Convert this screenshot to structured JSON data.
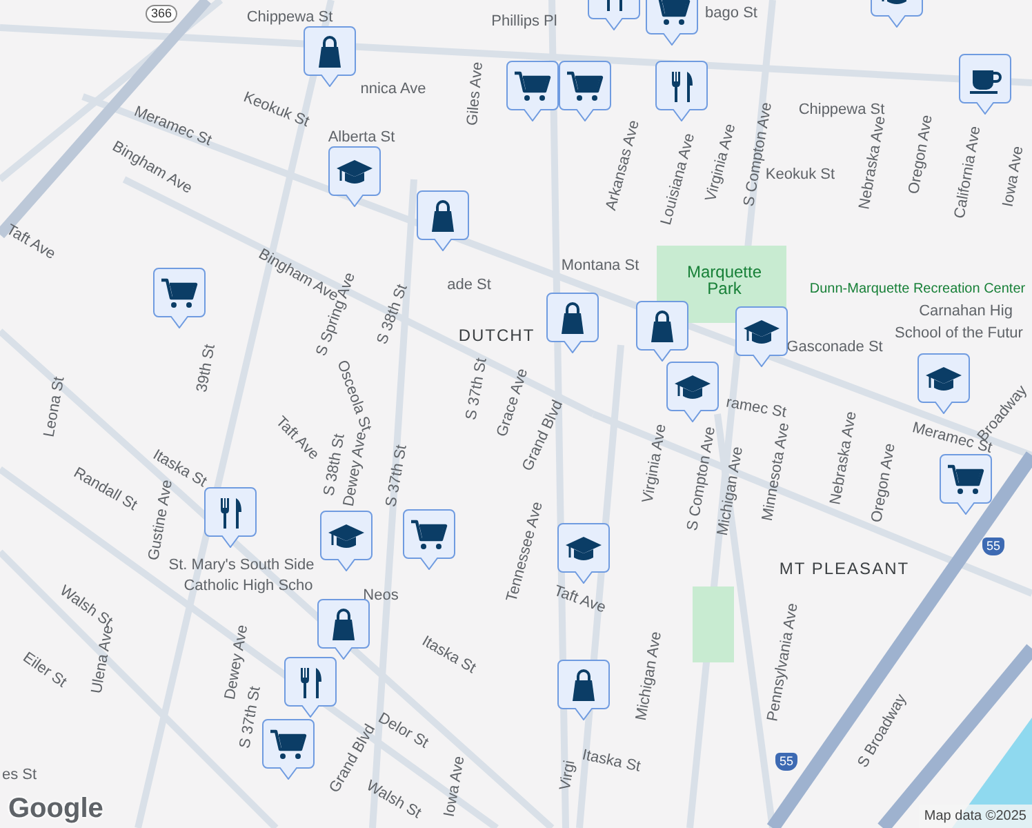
{
  "map": {
    "labels": [
      {
        "kind": "shield",
        "text": "366"
      },
      {
        "kind": "street",
        "text": "Chippewa St"
      },
      {
        "kind": "street",
        "text": "Phillips Pl"
      },
      {
        "kind": "street",
        "text": "bago St"
      },
      {
        "kind": "street",
        "text": "Meramec St"
      },
      {
        "kind": "street",
        "text": "Keokuk St"
      },
      {
        "kind": "street",
        "text": "nnica Ave"
      },
      {
        "kind": "street",
        "text": "Bingham Ave"
      },
      {
        "kind": "street",
        "text": "Giles Ave"
      },
      {
        "kind": "street",
        "text": "Chippewa St"
      },
      {
        "kind": "street",
        "text": "Alberta St"
      },
      {
        "kind": "street",
        "text": "Arkansas Ave"
      },
      {
        "kind": "street",
        "text": "Louisiana Ave"
      },
      {
        "kind": "street",
        "text": "Virginia Ave"
      },
      {
        "kind": "street",
        "text": "S Compton Ave"
      },
      {
        "kind": "street",
        "text": "Keokuk St"
      },
      {
        "kind": "street",
        "text": "Nebraska Ave"
      },
      {
        "kind": "street",
        "text": "Oregon Ave"
      },
      {
        "kind": "street",
        "text": "California Ave"
      },
      {
        "kind": "street",
        "text": "Iowa Ave"
      },
      {
        "kind": "street",
        "text": "Taft Ave"
      },
      {
        "kind": "street",
        "text": "Bingham Ave"
      },
      {
        "kind": "street",
        "text": "ade St"
      },
      {
        "kind": "street",
        "text": "Montana St"
      },
      {
        "kind": "park",
        "text": "Marquette Park"
      },
      {
        "kind": "park",
        "text": "Dunn-Marquette Recreation Center"
      },
      {
        "kind": "district",
        "text": "DUTCHT"
      },
      {
        "kind": "street",
        "text": "Gasconade St"
      },
      {
        "kind": "poi",
        "text": "Carnahan Hig"
      },
      {
        "kind": "poi",
        "text": "School of the Futur"
      },
      {
        "kind": "street",
        "text": "39th St"
      },
      {
        "kind": "street",
        "text": "S Spring Ave"
      },
      {
        "kind": "street",
        "text": "S 38th St"
      },
      {
        "kind": "street",
        "text": "Osceola St"
      },
      {
        "kind": "street",
        "text": "S 37th St"
      },
      {
        "kind": "street",
        "text": "Grace Ave"
      },
      {
        "kind": "street",
        "text": "Grand Blvd"
      },
      {
        "kind": "street",
        "text": "ramec St"
      },
      {
        "kind": "street",
        "text": "Meramec St"
      },
      {
        "kind": "street",
        "text": "Broadway"
      },
      {
        "kind": "street",
        "text": "Leona St"
      },
      {
        "kind": "street",
        "text": "Taft Ave"
      },
      {
        "kind": "street",
        "text": "S 38th St"
      },
      {
        "kind": "street",
        "text": "Dewey Ave"
      },
      {
        "kind": "street",
        "text": "S 37th St"
      },
      {
        "kind": "street",
        "text": "Itaska St"
      },
      {
        "kind": "street",
        "text": "Randall St"
      },
      {
        "kind": "street",
        "text": "Gustine Ave"
      },
      {
        "kind": "street",
        "text": "Virginia Ave"
      },
      {
        "kind": "street",
        "text": "S Compton Ave"
      },
      {
        "kind": "street",
        "text": "Michigan Ave"
      },
      {
        "kind": "street",
        "text": "Minnesota Ave"
      },
      {
        "kind": "street",
        "text": "Nebraska Ave"
      },
      {
        "kind": "street",
        "text": "Oregon Ave"
      },
      {
        "kind": "street",
        "text": "Neos"
      },
      {
        "kind": "street",
        "text": "Tennessee Ave"
      },
      {
        "kind": "district",
        "text": "MT PLEASANT"
      },
      {
        "kind": "poi",
        "text": "St. Mary's South Side"
      },
      {
        "kind": "poi",
        "text": "Catholic High Scho"
      },
      {
        "kind": "street",
        "text": "Taft Ave"
      },
      {
        "kind": "street",
        "text": "Walsh St"
      },
      {
        "kind": "street",
        "text": "Ulena Ave"
      },
      {
        "kind": "street",
        "text": "Eiler St"
      },
      {
        "kind": "street",
        "text": "Dewey Ave"
      },
      {
        "kind": "street",
        "text": "S 37th St"
      },
      {
        "kind": "street",
        "text": "Itaska St"
      },
      {
        "kind": "street",
        "text": "Michigan Ave"
      },
      {
        "kind": "street",
        "text": "Pennsylvania Ave"
      },
      {
        "kind": "street",
        "text": "S Broadway"
      },
      {
        "kind": "street",
        "text": "Delor St"
      },
      {
        "kind": "street",
        "text": "Grand Blvd"
      },
      {
        "kind": "street",
        "text": "Walsh St"
      },
      {
        "kind": "street",
        "text": "es St"
      },
      {
        "kind": "street",
        "text": "Itaska St"
      },
      {
        "kind": "street",
        "text": "Virgi"
      },
      {
        "kind": "street",
        "text": "Iowa Ave"
      },
      {
        "kind": "interstate",
        "text": "55"
      },
      {
        "kind": "interstate",
        "text": "55"
      }
    ],
    "markers": [
      {
        "kind": "restaurant"
      },
      {
        "kind": "grocery"
      },
      {
        "kind": "school"
      },
      {
        "kind": "shopping"
      },
      {
        "kind": "grocery"
      },
      {
        "kind": "grocery"
      },
      {
        "kind": "restaurant"
      },
      {
        "kind": "cafe"
      },
      {
        "kind": "school"
      },
      {
        "kind": "shopping"
      },
      {
        "kind": "grocery"
      },
      {
        "kind": "shopping"
      },
      {
        "kind": "shopping"
      },
      {
        "kind": "school"
      },
      {
        "kind": "school"
      },
      {
        "kind": "school"
      },
      {
        "kind": "grocery"
      },
      {
        "kind": "restaurant"
      },
      {
        "kind": "school"
      },
      {
        "kind": "grocery"
      },
      {
        "kind": "school"
      },
      {
        "kind": "shopping"
      },
      {
        "kind": "restaurant"
      },
      {
        "kind": "shopping"
      },
      {
        "kind": "grocery"
      }
    ],
    "logo": "Google",
    "attribution": "Map data ©2025"
  }
}
